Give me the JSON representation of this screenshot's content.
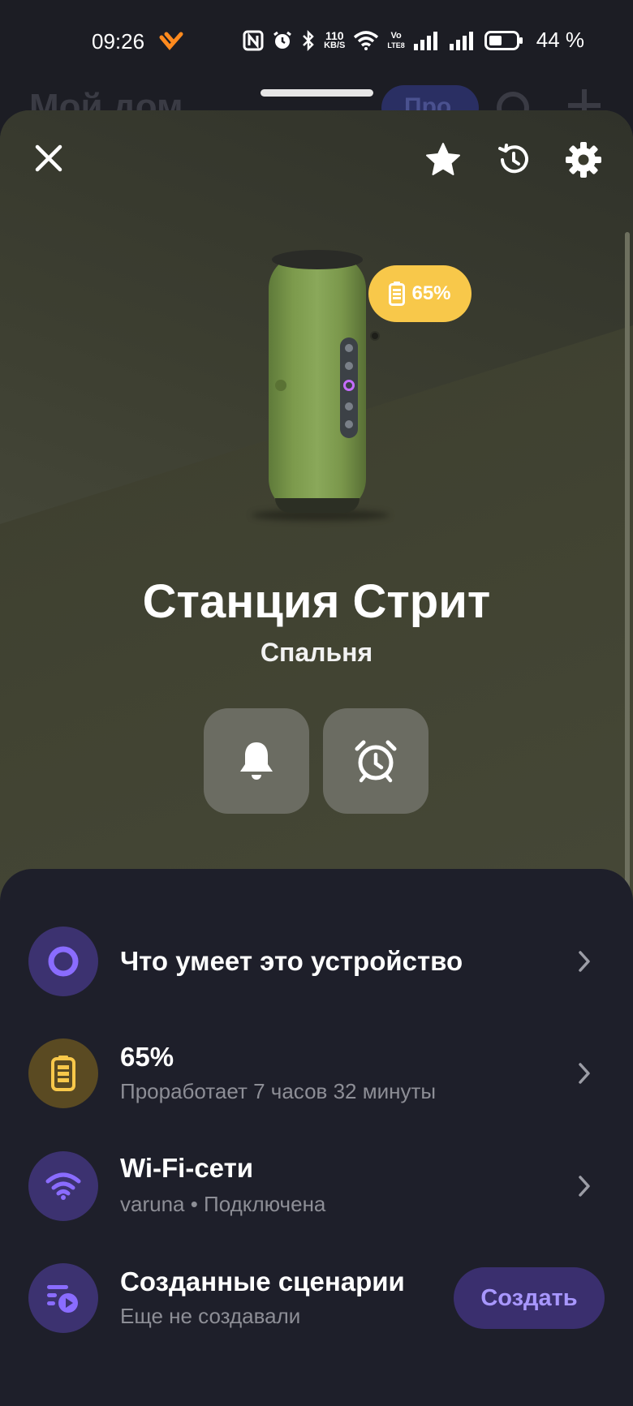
{
  "status_bar": {
    "time": "09:26",
    "net_speed_value": "110",
    "net_speed_unit": "KB/S",
    "volte_top": "Vo",
    "volte_bottom": "LTE8",
    "battery_percent": "44 %"
  },
  "background_page": {
    "title": "Мой дом",
    "chip_label": "Про"
  },
  "device": {
    "name": "Станция Стрит",
    "room": "Спальня",
    "battery_badge": "65%"
  },
  "rows": [
    {
      "title": "Что умеет это устройство",
      "subtitle": ""
    },
    {
      "title": "65%",
      "subtitle": "Проработает 7 часов 32 минуты"
    },
    {
      "title": "Wi-Fi-сети",
      "subtitle": "varuna • Подключена"
    },
    {
      "title": "Созданные сценарии",
      "subtitle": "Еще не создавали"
    }
  ],
  "create_button": "Создать",
  "icons": [
    "close-icon",
    "star-icon",
    "history-icon",
    "gear-icon",
    "bell-icon",
    "alarm-clock-icon",
    "alice-icon",
    "battery-icon",
    "wifi-icon",
    "scenario-icon",
    "chevron-right-icon"
  ],
  "colors": {
    "accent_purple": "#8a6cff",
    "battery_yellow": "#f8c84a",
    "panel_bg": "#1e1f2a"
  }
}
